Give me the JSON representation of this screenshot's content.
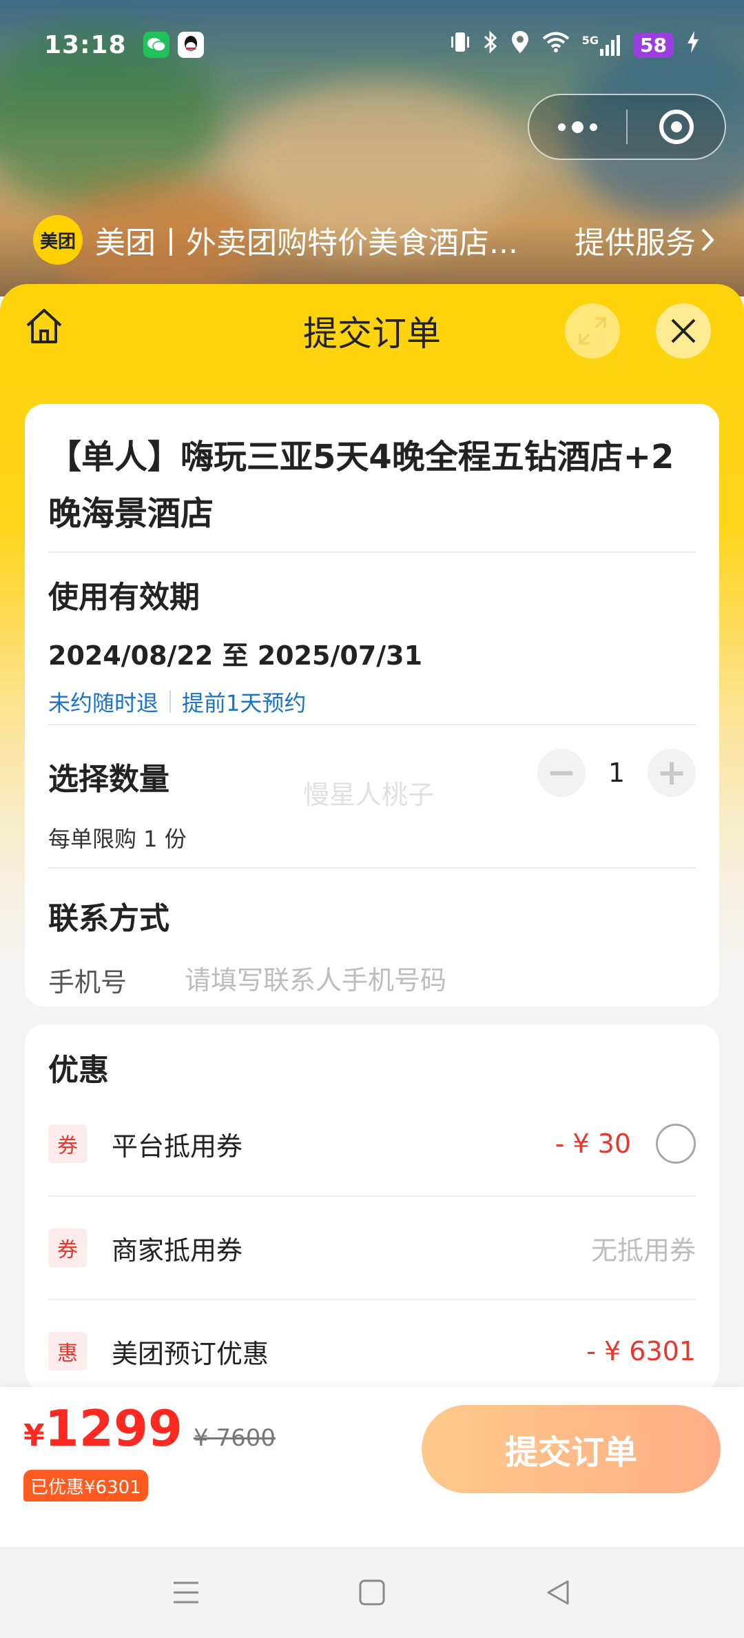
{
  "status_bar": {
    "time": "13:18",
    "battery": "58",
    "network": "5G"
  },
  "miniprogram": {
    "logo_text": "美团",
    "title": "美团丨外卖团购特价美食酒店...",
    "service_link": "提供服务"
  },
  "sheet": {
    "title": "提交订单"
  },
  "product": {
    "title": "【单人】嗨玩三亚5天4晚全程五钻酒店+2晚海景酒店"
  },
  "validity": {
    "heading": "使用有效期",
    "date_range": "2024/08/22 至 2025/07/31",
    "tag_refund": "未约随时退",
    "tag_booking": "提前1天预约"
  },
  "quantity": {
    "heading": "选择数量",
    "limit": "每单限购 1 份",
    "value": "1",
    "minus": "−",
    "plus": "+",
    "watermark": "慢星人桃子"
  },
  "contact": {
    "heading": "联系方式",
    "phone_label": "手机号",
    "phone_placeholder": "请填写联系人手机号码"
  },
  "discounts": {
    "heading": "优惠",
    "items": [
      {
        "icon_text": "券",
        "label": "平台抵用券",
        "value": "- ¥ 30"
      },
      {
        "icon_text": "券",
        "label": "商家抵用券",
        "value": "无抵用券"
      },
      {
        "icon_text": "惠",
        "label": "美团预订优惠",
        "value": "- ¥ 6301"
      }
    ]
  },
  "checkout": {
    "currency": "¥",
    "price": "1299",
    "original_price": "¥ 7600",
    "saved": "已优惠¥6301",
    "submit_label": "提交订单"
  },
  "colors": {
    "brand_yellow": "#ffd30a",
    "price_red": "#ff2a1f",
    "link_blue": "#1a73c8",
    "submit_gradient_start": "#ffc98a",
    "submit_gradient_end": "#ffae86"
  }
}
